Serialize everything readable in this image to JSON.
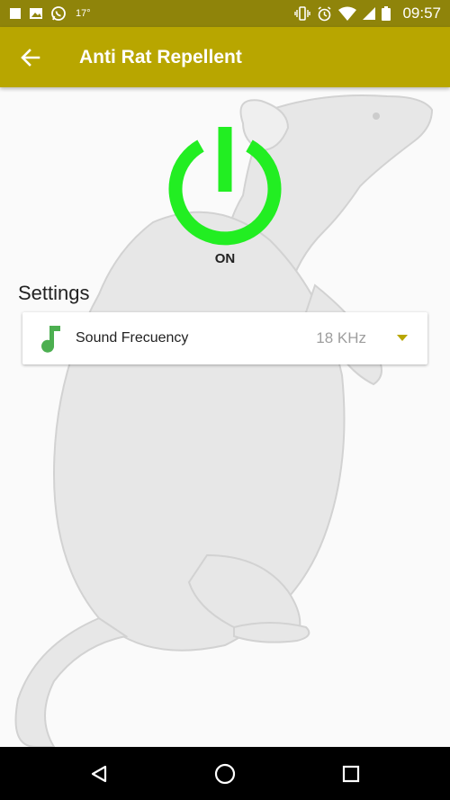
{
  "status_bar": {
    "temperature": "17°",
    "time": "09:57",
    "left_icons": [
      "stop-icon",
      "image-icon",
      "whatsapp-icon"
    ],
    "right_icons": [
      "vibrate-icon",
      "alarm-icon",
      "wifi-icon",
      "signal-icon",
      "battery-icon"
    ]
  },
  "app_bar": {
    "title": "Anti Rat Repellent",
    "back_icon": "arrow-left-icon",
    "color": "#b8a600"
  },
  "power": {
    "state_label": "ON",
    "color": "#22ee22"
  },
  "settings": {
    "heading": "Settings",
    "sound_frequency": {
      "label": "Sound Frecuency",
      "value": "18 KHz",
      "icon": "music-note-icon",
      "icon_color": "#4caf50"
    }
  },
  "nav_bar": {
    "buttons": [
      "back-triangle-icon",
      "home-circle-icon",
      "recents-square-icon"
    ]
  }
}
